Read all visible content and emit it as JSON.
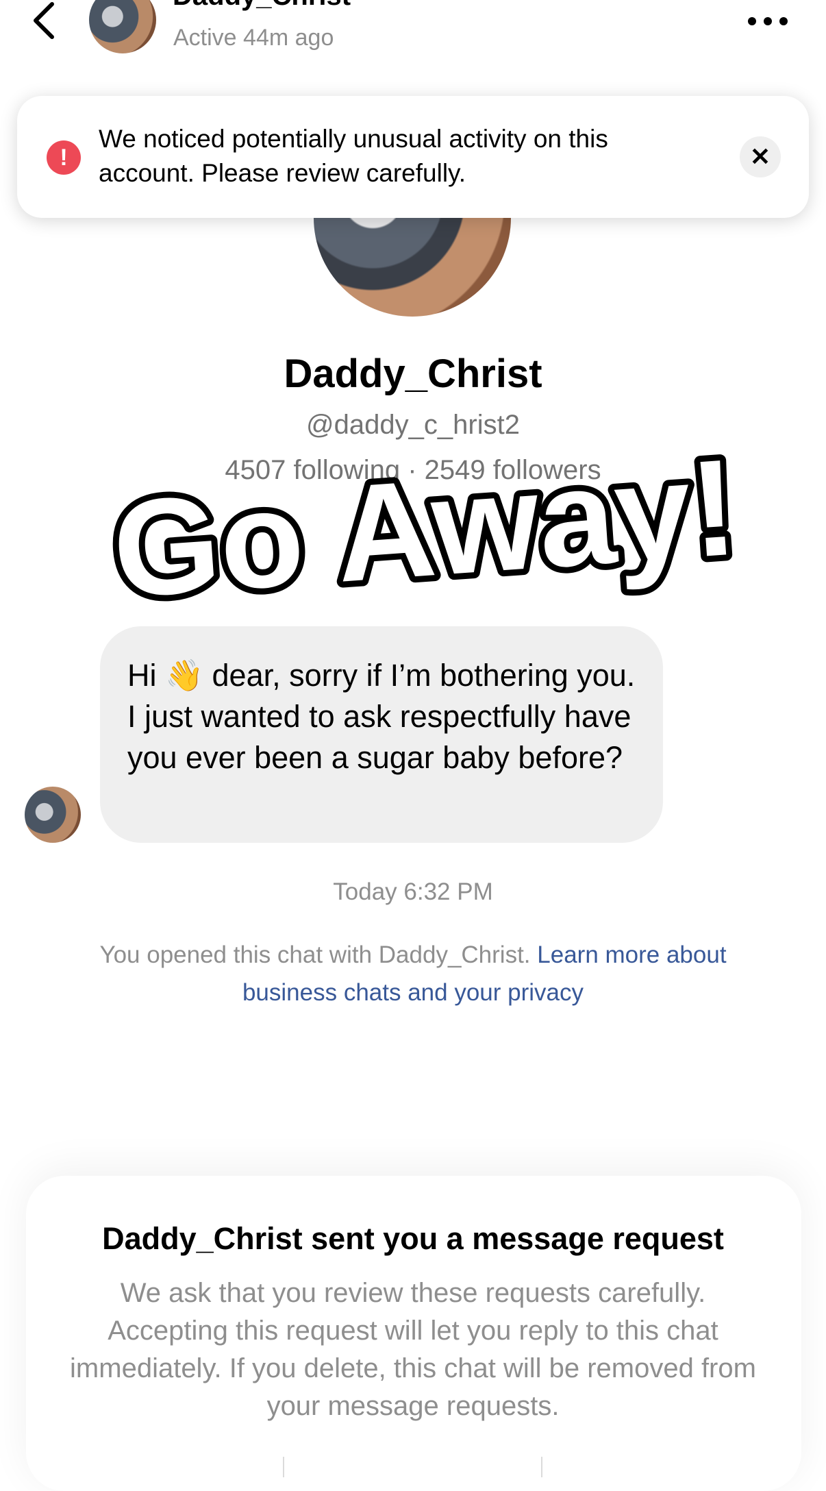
{
  "header": {
    "name": "Daddy_Christ",
    "status": "Active 44m ago",
    "back_icon": "chevron-left-icon",
    "more_icon": "more-horizontal-icon"
  },
  "warning": {
    "text": "We noticed potentially unusual activity on this account. Please review carefully.",
    "icon": "exclamation-icon",
    "icon_color": "#ed4956",
    "close_icon": "close-icon"
  },
  "profile": {
    "name": "Daddy_Christ",
    "handle": "@daddy_c_hrist2",
    "stats": "4507 following · 2549 followers"
  },
  "overlay": {
    "text": "Go Away!"
  },
  "message": {
    "text": "Hi 👋 dear, sorry if I’m bothering you. I just wanted to ask respectfully have you ever been a sugar baby before?"
  },
  "timestamp": "Today 6:32 PM",
  "privacy": {
    "text": "You opened this chat with Daddy_Christ. ",
    "link": "Learn more about business chats and your privacy",
    "link_color": "#385898"
  },
  "request": {
    "title": "Daddy_Christ sent you a message request",
    "body": "We ask that you review these requests carefully. Accepting this request will let you reply to this chat immediately. If you delete, this chat will be removed from your message requests."
  }
}
